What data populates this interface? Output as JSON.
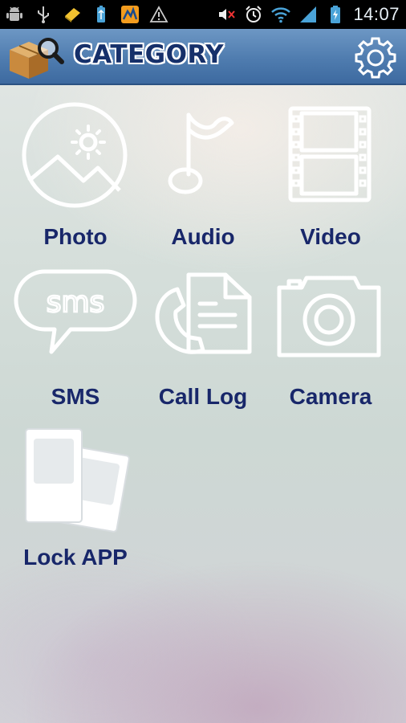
{
  "status_bar": {
    "left_icons": [
      "android-debug-icon",
      "usb-icon",
      "sd-card-icon",
      "battery-usb-icon",
      "app-update-icon",
      "warning-icon"
    ],
    "right_icons": [
      "mute-icon",
      "alarm-icon",
      "wifi-icon",
      "signal-icon",
      "battery-charging-icon"
    ],
    "time": "14:07"
  },
  "header": {
    "title": "CATEGORY",
    "logo_icon": "box-search-icon",
    "settings_icon": "gear-icon"
  },
  "categories": [
    {
      "label": "Photo",
      "icon": "photo-icon"
    },
    {
      "label": "Audio",
      "icon": "music-note-icon"
    },
    {
      "label": "Video",
      "icon": "film-strip-icon"
    },
    {
      "label": "SMS",
      "icon": "sms-bubble-icon"
    },
    {
      "label": "Call Log",
      "icon": "call-log-icon"
    },
    {
      "label": "Camera",
      "icon": "camera-icon"
    },
    {
      "label": "Lock APP",
      "icon": "lock-app-icon"
    }
  ],
  "colors": {
    "header_top": "#6d97c4",
    "header_bottom": "#3d6aa0",
    "label_text": "#18276a",
    "title_text": "#16306a"
  }
}
